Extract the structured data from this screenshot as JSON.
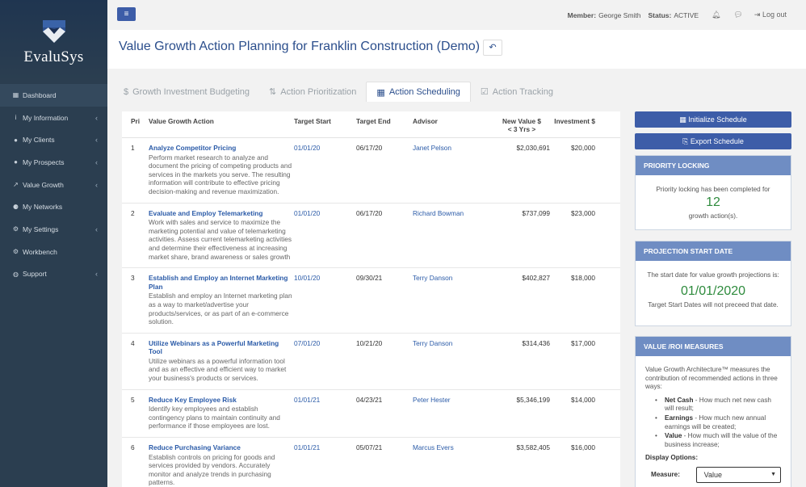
{
  "brand": {
    "name": "EvaluSys"
  },
  "sidebar": {
    "items": [
      {
        "icon": "dashboard-icon",
        "glyph": "▦",
        "label": "Dashboard",
        "caret": false
      },
      {
        "icon": "info-icon",
        "glyph": "i",
        "label": "My Information",
        "caret": true
      },
      {
        "icon": "users-icon",
        "glyph": "●",
        "label": "My Clients",
        "caret": true
      },
      {
        "icon": "users-icon",
        "glyph": "●",
        "label": "My Prospects",
        "caret": true
      },
      {
        "icon": "chart-icon",
        "glyph": "↗",
        "label": "Value Growth",
        "caret": true
      },
      {
        "icon": "network-icon",
        "glyph": "⚈",
        "label": "My Networks",
        "caret": false
      },
      {
        "icon": "gear-icon",
        "glyph": "⚙",
        "label": "My Settings",
        "caret": true
      },
      {
        "icon": "gears-icon",
        "glyph": "⚙",
        "label": "Workbench",
        "caret": false
      },
      {
        "icon": "globe-icon",
        "glyph": "◍",
        "label": "Support",
        "caret": true
      }
    ]
  },
  "header": {
    "member_label": "Member:",
    "member_name": "George Smith",
    "status_label": "Status:",
    "status_value": "ACTIVE",
    "logout_label": "Log out"
  },
  "page": {
    "title": "Value Growth Action Planning for Franklin Construction (Demo)"
  },
  "tabs": [
    {
      "icon": "$",
      "label": "Growth Investment Budgeting",
      "active": false
    },
    {
      "icon": "⇅",
      "label": "Action Prioritization",
      "active": false
    },
    {
      "icon": "▦",
      "label": "Action Scheduling",
      "active": true
    },
    {
      "icon": "☑",
      "label": "Action Tracking",
      "active": false
    }
  ],
  "table": {
    "headers": {
      "pri": "Pri",
      "action": "Value Growth Action",
      "target_start": "Target Start",
      "target_end": "Target End",
      "advisor": "Advisor",
      "new_value": "New Value $",
      "new_value_sub": "< 3 Yrs >",
      "investment": "Investment $"
    },
    "rows": [
      {
        "pri": "1",
        "title": "Analyze Competitor Pricing",
        "desc": "Perform market research to analyze and document the pricing of competing products and services in the markets you serve. The resulting information will contribute to effective pricing decision-making and revenue maximization.",
        "start": "01/01/20",
        "end": "06/17/20",
        "advisor": "Janet Pelson",
        "new_value": "$2,030,691",
        "investment": "$20,000"
      },
      {
        "pri": "2",
        "title": "Evaluate and Employ Telemarketing",
        "desc": "Work with sales and service to maximize the marketing potential and value of telemarketing activities. Assess current telemarketing activities and determine their effectiveness at increasing market share, brand awareness or sales growth",
        "start": "01/01/20",
        "end": "06/17/20",
        "advisor": "Richard Bowman",
        "new_value": "$737,099",
        "investment": "$23,000"
      },
      {
        "pri": "3",
        "title": "Establish and Employ an Internet Marketing Plan",
        "desc": "Establish and employ an Internet marketing plan as a way to market/advertise your products/services, or as part of an e-commerce solution.",
        "start": "10/01/20",
        "end": "09/30/21",
        "advisor": "Terry Danson",
        "new_value": "$402,827",
        "investment": "$18,000"
      },
      {
        "pri": "4",
        "title": "Utilize Webinars as a Powerful Marketing Tool",
        "desc": "Utilize webinars as a powerful information tool and as an effective and efficient way to market your business's products or services.",
        "start": "07/01/20",
        "end": "10/21/20",
        "advisor": "Terry Danson",
        "new_value": "$314,436",
        "investment": "$17,000"
      },
      {
        "pri": "5",
        "title": "Reduce Key Employee Risk",
        "desc": "Identify key employees and establish contingency plans to maintain continuity and performance if those employees are lost.",
        "start": "01/01/21",
        "end": "04/23/21",
        "advisor": "Peter Hester",
        "new_value": "$5,346,199",
        "investment": "$14,000"
      },
      {
        "pri": "6",
        "title": "Reduce Purchasing Variance",
        "desc": "Establish controls on pricing for goods and services provided by vendors. Accurately monitor and analyze trends in purchasing patterns.",
        "start": "01/01/21",
        "end": "05/07/21",
        "advisor": "Marcus Evers",
        "new_value": "$3,582,405",
        "investment": "$16,000"
      }
    ]
  },
  "actions": {
    "initialize_label": "Initialize Schedule",
    "export_label": "Export Schedule"
  },
  "priority_locking": {
    "title": "PRIORITY LOCKING",
    "text_before": "Priority locking has been completed for",
    "count": "12",
    "text_after": "growth action(s)."
  },
  "projection_start": {
    "title": "PROJECTION START DATE",
    "text_before": "The start date for value growth projections is:",
    "date": "01/01/2020",
    "text_after": "Target Start Dates will not preceed that date."
  },
  "value_roi": {
    "title": "VALUE /ROI MEASURES",
    "intro": "Value Growth Architecture™ measures the contribution of recommended actions in three ways:",
    "measures": [
      {
        "name": "Net Cash",
        "desc": " - How much net new cash will result;"
      },
      {
        "name": "Earnings",
        "desc": " - How much new annual earnings will be created;"
      },
      {
        "name": "Value",
        "desc": " - How much will the value of the business increase;"
      }
    ],
    "display_options_label": "Display Options:",
    "measure_label": "Measure:",
    "measure_value": "Value"
  },
  "colors": {
    "sidebar_bg": "#2b3e50",
    "accent": "#3d5da8",
    "card_header": "#6f8dc3",
    "highlight_green": "#2e8b3d",
    "link": "#2b5ba8"
  }
}
